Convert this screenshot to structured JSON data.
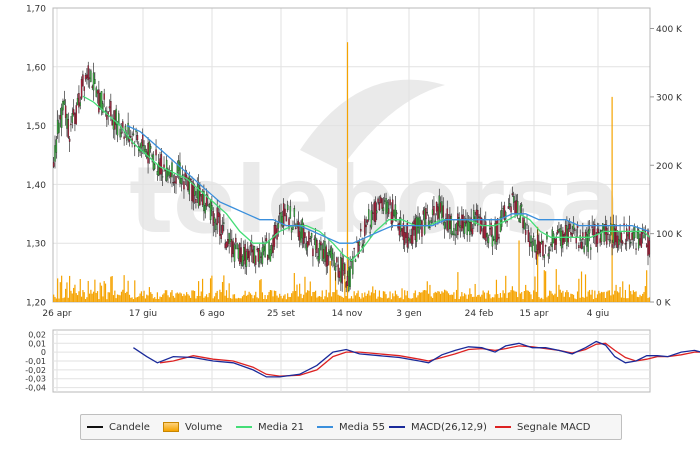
{
  "watermark": "teleborsa",
  "colors": {
    "up": "#3cb043",
    "down": "#b0203c",
    "wick": "#111111",
    "volume": "#f5a300",
    "ma21": "#44dd77",
    "ma55": "#3a8fdc",
    "macd": "#1a2a9a",
    "signal": "#dd2222",
    "grid": "#e2e2e2",
    "frame": "#b8b8b8",
    "watermark": "#eaeaea"
  },
  "chart_data": [
    {
      "type": "candlestick",
      "x_labels": [
        "26 apr",
        "17 giu",
        "6 ago",
        "25 set",
        "14 nov",
        "3 gen",
        "24 feb",
        "15 apr",
        "4 giu"
      ],
      "y_ticks": [
        "1,70",
        "1,60",
        "1,50",
        "1,40",
        "1,30",
        "1,20"
      ],
      "ylim": [
        1.2,
        1.7
      ],
      "volume_ticks": [
        "400 K",
        "300 K",
        "200 K",
        "100 K",
        "0 K"
      ],
      "volume_lim": [
        0,
        430000
      ],
      "grid": true,
      "price_path": [
        [
          0,
          1.43
        ],
        [
          3,
          1.5
        ],
        [
          8,
          1.53
        ],
        [
          12,
          1.49
        ],
        [
          17,
          1.52
        ],
        [
          23,
          1.58
        ],
        [
          27,
          1.6
        ],
        [
          32,
          1.55
        ],
        [
          40,
          1.53
        ],
        [
          50,
          1.5
        ],
        [
          62,
          1.48
        ],
        [
          72,
          1.45
        ],
        [
          82,
          1.43
        ],
        [
          94,
          1.42
        ],
        [
          105,
          1.39
        ],
        [
          115,
          1.37
        ],
        [
          123,
          1.34
        ],
        [
          131,
          1.3
        ],
        [
          140,
          1.28
        ],
        [
          152,
          1.28
        ],
        [
          163,
          1.29
        ],
        [
          172,
          1.35
        ],
        [
          180,
          1.34
        ],
        [
          190,
          1.31
        ],
        [
          200,
          1.29
        ],
        [
          210,
          1.27
        ],
        [
          218,
          1.25
        ],
        [
          222,
          1.24
        ],
        [
          226,
          1.27
        ],
        [
          232,
          1.31
        ],
        [
          240,
          1.35
        ],
        [
          248,
          1.36
        ],
        [
          256,
          1.35
        ],
        [
          264,
          1.31
        ],
        [
          272,
          1.32
        ],
        [
          280,
          1.34
        ],
        [
          290,
          1.36
        ],
        [
          298,
          1.33
        ],
        [
          308,
          1.33
        ],
        [
          318,
          1.34
        ],
        [
          328,
          1.31
        ],
        [
          336,
          1.33
        ],
        [
          343,
          1.36
        ],
        [
          348,
          1.37
        ],
        [
          353,
          1.34
        ],
        [
          358,
          1.3
        ],
        [
          365,
          1.29
        ],
        [
          373,
          1.3
        ],
        [
          382,
          1.31
        ],
        [
          390,
          1.32
        ],
        [
          398,
          1.3
        ],
        [
          406,
          1.31
        ],
        [
          414,
          1.32
        ],
        [
          420,
          1.31
        ],
        [
          430,
          1.32
        ],
        [
          438,
          1.31
        ],
        [
          448,
          1.3
        ]
      ],
      "ma21_path": [
        [
          22,
          1.55
        ],
        [
          30,
          1.54
        ],
        [
          40,
          1.52
        ],
        [
          50,
          1.5
        ],
        [
          60,
          1.47
        ],
        [
          70,
          1.45
        ],
        [
          80,
          1.43
        ],
        [
          90,
          1.42
        ],
        [
          100,
          1.41
        ],
        [
          110,
          1.39
        ],
        [
          120,
          1.37
        ],
        [
          130,
          1.35
        ],
        [
          140,
          1.32
        ],
        [
          150,
          1.3
        ],
        [
          160,
          1.3
        ],
        [
          170,
          1.32
        ],
        [
          180,
          1.33
        ],
        [
          190,
          1.33
        ],
        [
          200,
          1.32
        ],
        [
          210,
          1.3
        ],
        [
          218,
          1.28
        ],
        [
          224,
          1.27
        ],
        [
          232,
          1.29
        ],
        [
          242,
          1.32
        ],
        [
          252,
          1.34
        ],
        [
          262,
          1.34
        ],
        [
          272,
          1.33
        ],
        [
          282,
          1.33
        ],
        [
          292,
          1.34
        ],
        [
          302,
          1.34
        ],
        [
          312,
          1.34
        ],
        [
          322,
          1.33
        ],
        [
          332,
          1.33
        ],
        [
          342,
          1.34
        ],
        [
          350,
          1.35
        ],
        [
          358,
          1.34
        ],
        [
          366,
          1.32
        ],
        [
          374,
          1.31
        ],
        [
          384,
          1.31
        ],
        [
          394,
          1.31
        ],
        [
          404,
          1.31
        ],
        [
          414,
          1.32
        ],
        [
          424,
          1.32
        ],
        [
          434,
          1.32
        ],
        [
          444,
          1.32
        ],
        [
          448,
          1.31
        ]
      ],
      "ma55_path": [
        [
          55,
          1.5
        ],
        [
          65,
          1.49
        ],
        [
          75,
          1.47
        ],
        [
          85,
          1.45
        ],
        [
          95,
          1.43
        ],
        [
          105,
          1.41
        ],
        [
          115,
          1.39
        ],
        [
          125,
          1.37
        ],
        [
          135,
          1.36
        ],
        [
          145,
          1.35
        ],
        [
          155,
          1.34
        ],
        [
          165,
          1.34
        ],
        [
          175,
          1.33
        ],
        [
          185,
          1.33
        ],
        [
          195,
          1.32
        ],
        [
          205,
          1.31
        ],
        [
          215,
          1.3
        ],
        [
          225,
          1.3
        ],
        [
          235,
          1.31
        ],
        [
          245,
          1.32
        ],
        [
          255,
          1.33
        ],
        [
          265,
          1.33
        ],
        [
          275,
          1.33
        ],
        [
          285,
          1.33
        ],
        [
          295,
          1.34
        ],
        [
          305,
          1.34
        ],
        [
          315,
          1.34
        ],
        [
          325,
          1.34
        ],
        [
          335,
          1.34
        ],
        [
          345,
          1.35
        ],
        [
          355,
          1.35
        ],
        [
          365,
          1.34
        ],
        [
          375,
          1.34
        ],
        [
          385,
          1.34
        ],
        [
          395,
          1.33
        ],
        [
          405,
          1.33
        ],
        [
          415,
          1.33
        ],
        [
          425,
          1.33
        ],
        [
          435,
          1.33
        ],
        [
          448,
          1.32
        ]
      ]
    },
    {
      "type": "line",
      "y_ticks": [
        "0,02",
        "0,01",
        "0",
        "-0,01",
        "-0,02",
        "-0,03",
        "-0,04"
      ],
      "ylim": [
        -0.045,
        0.025
      ],
      "macd_path": [
        [
          0,
          0.005
        ],
        [
          10,
          -0.005
        ],
        [
          18,
          -0.012
        ],
        [
          30,
          -0.005
        ],
        [
          45,
          -0.006
        ],
        [
          60,
          -0.01
        ],
        [
          75,
          -0.012
        ],
        [
          90,
          -0.02
        ],
        [
          100,
          -0.028
        ],
        [
          110,
          -0.028
        ],
        [
          125,
          -0.025
        ],
        [
          138,
          -0.015
        ],
        [
          150,
          0.0
        ],
        [
          160,
          0.003
        ],
        [
          170,
          -0.002
        ],
        [
          185,
          -0.004
        ],
        [
          200,
          -0.006
        ],
        [
          215,
          -0.01
        ],
        [
          222,
          -0.012
        ],
        [
          232,
          -0.003
        ],
        [
          242,
          0.002
        ],
        [
          252,
          0.006
        ],
        [
          262,
          0.005
        ],
        [
          272,
          0.0
        ],
        [
          280,
          0.007
        ],
        [
          290,
          0.01
        ],
        [
          300,
          0.005
        ],
        [
          310,
          0.005
        ],
        [
          320,
          0.002
        ],
        [
          330,
          -0.002
        ],
        [
          340,
          0.005
        ],
        [
          348,
          0.012
        ],
        [
          355,
          0.008
        ],
        [
          362,
          -0.005
        ],
        [
          370,
          -0.012
        ],
        [
          378,
          -0.01
        ],
        [
          386,
          -0.004
        ],
        [
          394,
          -0.004
        ],
        [
          402,
          -0.005
        ],
        [
          412,
          0.0
        ],
        [
          422,
          0.002
        ],
        [
          432,
          -0.002
        ],
        [
          440,
          -0.002
        ],
        [
          448,
          -0.005
        ]
      ],
      "signal_path": [
        [
          20,
          -0.012
        ],
        [
          30,
          -0.01
        ],
        [
          45,
          -0.004
        ],
        [
          60,
          -0.008
        ],
        [
          75,
          -0.01
        ],
        [
          90,
          -0.017
        ],
        [
          100,
          -0.025
        ],
        [
          110,
          -0.027
        ],
        [
          125,
          -0.026
        ],
        [
          138,
          -0.02
        ],
        [
          150,
          -0.005
        ],
        [
          160,
          0.0
        ],
        [
          170,
          0.0
        ],
        [
          185,
          -0.002
        ],
        [
          200,
          -0.004
        ],
        [
          215,
          -0.008
        ],
        [
          222,
          -0.01
        ],
        [
          232,
          -0.006
        ],
        [
          242,
          -0.002
        ],
        [
          252,
          0.003
        ],
        [
          262,
          0.004
        ],
        [
          272,
          0.002
        ],
        [
          280,
          0.004
        ],
        [
          290,
          0.007
        ],
        [
          300,
          0.006
        ],
        [
          310,
          0.004
        ],
        [
          320,
          0.002
        ],
        [
          330,
          -0.001
        ],
        [
          340,
          0.003
        ],
        [
          348,
          0.009
        ],
        [
          355,
          0.01
        ],
        [
          362,
          0.002
        ],
        [
          370,
          -0.006
        ],
        [
          378,
          -0.01
        ],
        [
          386,
          -0.008
        ],
        [
          394,
          -0.005
        ],
        [
          402,
          -0.005
        ],
        [
          412,
          -0.003
        ],
        [
          422,
          0.0
        ],
        [
          432,
          0.0
        ],
        [
          440,
          -0.001
        ],
        [
          448,
          -0.003
        ]
      ]
    }
  ],
  "legend": [
    {
      "key": "candles",
      "label": "Candele",
      "kind": "line",
      "color": "#111111"
    },
    {
      "key": "volume",
      "label": "Volume",
      "kind": "bar",
      "color": "#f5a300"
    },
    {
      "key": "ma21",
      "label": "Media 21",
      "kind": "line",
      "color": "#44dd77"
    },
    {
      "key": "ma55",
      "label": "Media 55",
      "kind": "line",
      "color": "#3a8fdc"
    },
    {
      "key": "macd",
      "label": "MACD(26,12,9)",
      "kind": "line",
      "color": "#1a2a9a"
    },
    {
      "key": "signal",
      "label": "Segnale MACD",
      "kind": "line",
      "color": "#dd2222"
    }
  ]
}
